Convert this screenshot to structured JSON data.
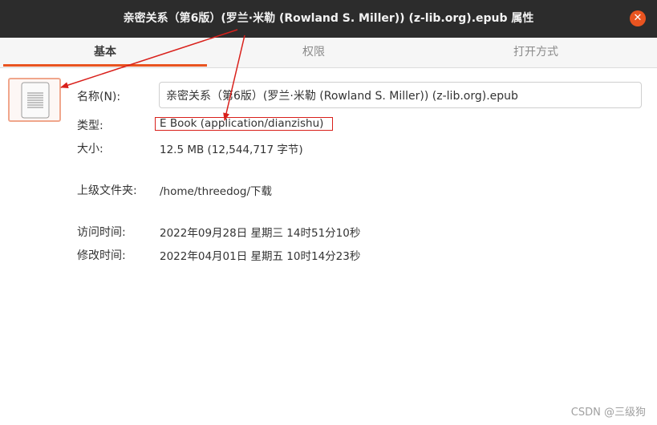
{
  "window": {
    "title": "亲密关系（第6版）(罗兰·米勒 (Rowland S. Miller)) (z-lib.org).epub 属性",
    "close_icon": "close-icon",
    "accent": "#e95420"
  },
  "tabs": [
    {
      "label": "基本",
      "active": true
    },
    {
      "label": "权限",
      "active": false
    },
    {
      "label": "打开方式",
      "active": false
    }
  ],
  "file": {
    "icon": "document-icon",
    "name_label": "名称(N):",
    "name_value": "亲密关系（第6版）(罗兰·米勒 (Rowland S. Miller)) (z-lib.org).epub",
    "type_label": "类型:",
    "type_value": "E Book (application/dianzishu)",
    "size_label": "大小:",
    "size_value": "12.5 MB (12,544,717 字节)",
    "parent_label": "上级文件夹:",
    "parent_value": "/home/threedog/下载",
    "accessed_label": "访问时间:",
    "accessed_value": "2022年09月28日 星期三 14时51分10秒",
    "modified_label": "修改时间:",
    "modified_value": "2022年04月01日 星期五 10时14分23秒"
  },
  "annotation_color": "#d9201b",
  "watermark": "CSDN @三级狗"
}
